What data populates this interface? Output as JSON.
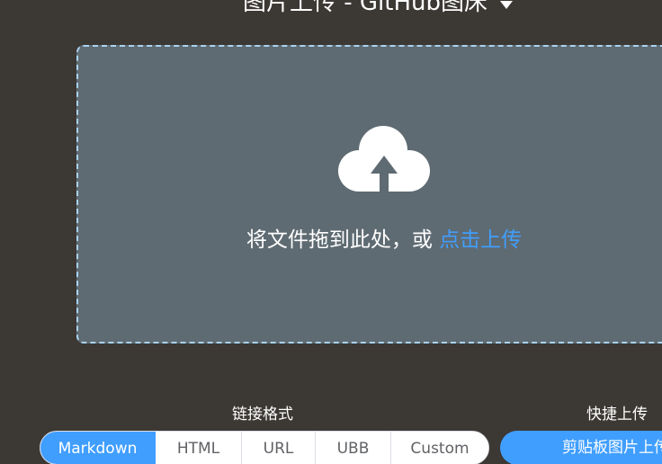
{
  "header": {
    "title": "图片上传 - GitHub图床",
    "dropdown_icon": "caret-down-icon"
  },
  "upload": {
    "icon": "cloud-upload-icon",
    "prompt": "将文件拖到此处，或",
    "link": "点击上传"
  },
  "link_format": {
    "label": "链接格式",
    "options": [
      "Markdown",
      "HTML",
      "URL",
      "UBB",
      "Custom"
    ],
    "selected": "Markdown"
  },
  "quick_upload": {
    "label": "快捷上传",
    "button": "剪贴板图片上传"
  },
  "colors": {
    "background": "#3c3834",
    "dropzone": "#5f6b72",
    "dropzone_border": "#a9d3f2",
    "accent": "#409eff"
  }
}
